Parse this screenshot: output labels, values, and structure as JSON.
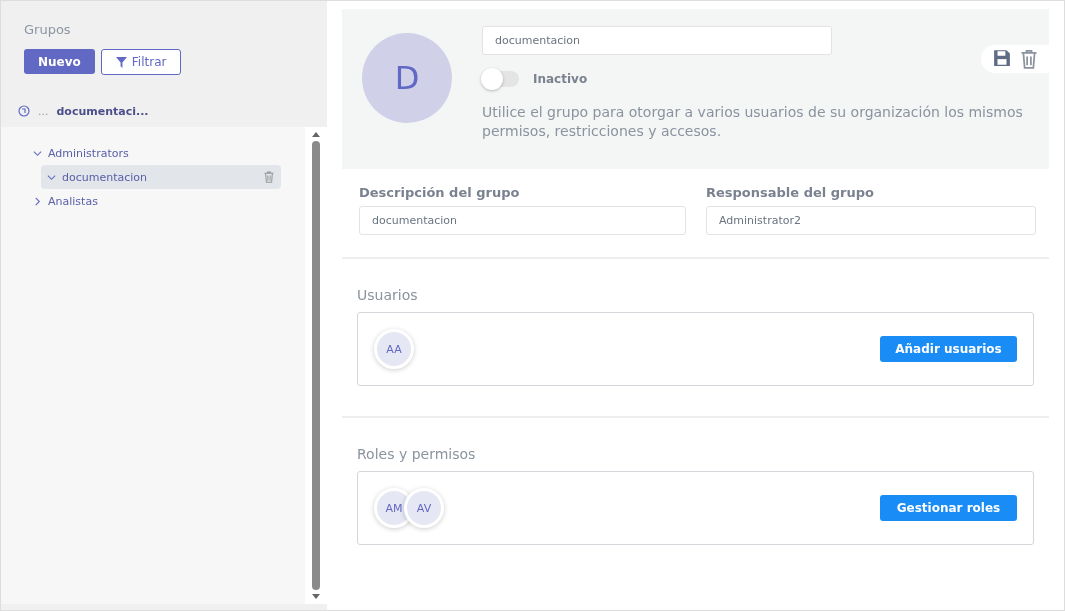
{
  "sidebar": {
    "title": "Grupos",
    "new_button": "Nuevo",
    "filter_button": "Filtrar",
    "breadcrumb": {
      "ellipsis": "...",
      "current": "documentaci..."
    },
    "tree": [
      {
        "label": "Administrators",
        "expanded": true,
        "selected": false,
        "children": [
          {
            "label": "documentacion",
            "expanded": true,
            "selected": true
          }
        ]
      },
      {
        "label": "Analistas",
        "expanded": false,
        "selected": false
      }
    ]
  },
  "group": {
    "avatar": "D",
    "name": "documentacion",
    "active": false,
    "status_label": "Inactivo",
    "description_text": "Utilice el grupo para otorgar a varios usuarios de su organización los mismos permisos, restricciones y accesos."
  },
  "fields": [
    {
      "label": "Descripción del grupo",
      "value": "documentacion"
    },
    {
      "label": "Responsable del grupo",
      "value": "Administrator2"
    }
  ],
  "sections": [
    {
      "title": "Usuarios",
      "avatars": [
        "AA"
      ],
      "button": "Añadir usuarios"
    },
    {
      "title": "Roles y permisos",
      "avatars": [
        "AM",
        "AV"
      ],
      "button": "Gestionar roles"
    }
  ]
}
